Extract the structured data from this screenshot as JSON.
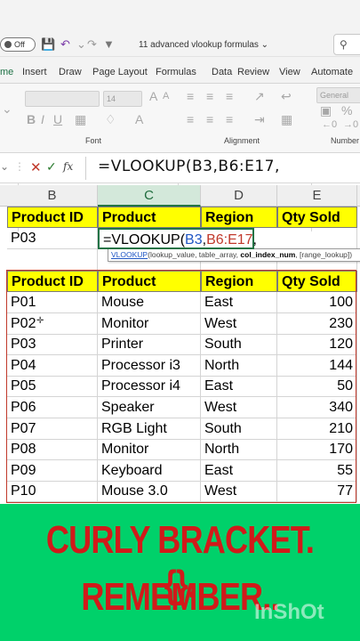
{
  "titlebar": {
    "autosave_label": "Off",
    "doc_title": "11 advanced vlookup formulas ⌄",
    "search_icon": "search-icon"
  },
  "ribbon_tabs": [
    "me",
    "Insert",
    "Draw",
    "Page Layout",
    "Formulas",
    "Data",
    "Review",
    "View",
    "Automate"
  ],
  "ribbon": {
    "font_size": "14",
    "style_label": "General",
    "group_font": "Font",
    "group_alignment": "Alignment",
    "group_number": "Number"
  },
  "formula_bar": {
    "formula": "=VLOOKUP(B3,B6:E17,",
    "fx_label": "fx"
  },
  "columns": [
    "B",
    "C",
    "D",
    "E"
  ],
  "selected_column": "C",
  "lookup_table": {
    "headers": [
      "Product ID",
      "Product",
      "Region",
      "Qty Sold"
    ],
    "input_id": "P03",
    "formula_prefix": "=VLOOKUP(",
    "formula_ref1": "B3",
    "formula_sep": ",",
    "formula_ref2": "B6:E17",
    "formula_tail": ","
  },
  "tooltip": {
    "fn": "VLOOKUP",
    "args_before": "(",
    "arg1": "lookup_value",
    "arg2": ", table_array, ",
    "arg3": "col_index_num",
    "arg4": ", [range_lookup])"
  },
  "data_table": {
    "headers": [
      "Product ID",
      "Product",
      "Region",
      "Qty Sold"
    ],
    "rows": [
      [
        "P01",
        "Mouse",
        "East",
        "100"
      ],
      [
        "P02",
        "Monitor",
        "West",
        "230"
      ],
      [
        "P03",
        "Printer",
        "South",
        "120"
      ],
      [
        "P04",
        "Processor i3",
        "North",
        "144"
      ],
      [
        "P05",
        "Processor i4",
        "East",
        "50"
      ],
      [
        "P06",
        "Speaker",
        "West",
        "340"
      ],
      [
        "P07",
        "RGB Light",
        "South",
        "210"
      ],
      [
        "P08",
        "Monitor",
        "North",
        "170"
      ],
      [
        "P09",
        "Keyboard",
        "East",
        "55"
      ],
      [
        "P10",
        "Mouse 3.0",
        "West",
        "77"
      ]
    ]
  },
  "banner": {
    "line1": "CURLY BRACKET.{}.",
    "line2": "REMEMBER..",
    "watermark": "InShOt",
    "bg_color": "#00d16a",
    "text_color": "#d11a1a"
  }
}
